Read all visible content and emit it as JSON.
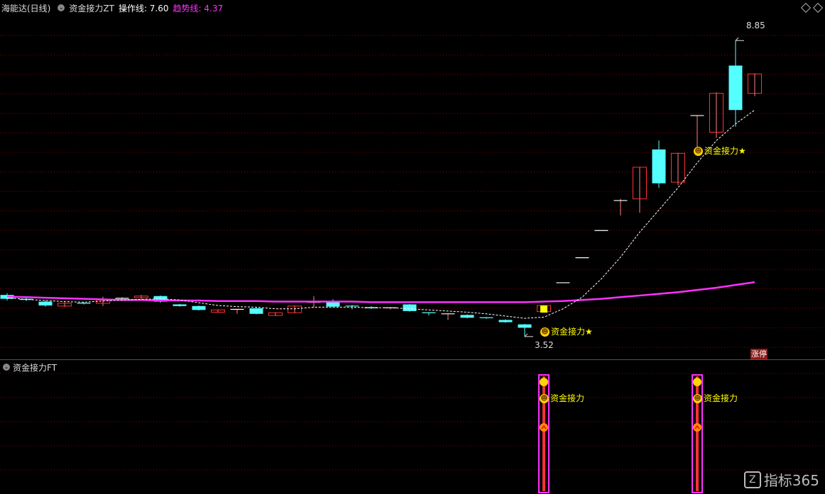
{
  "header": {
    "stock": "海能达(日线)",
    "indicator": "资金接力ZT",
    "op_label": "操作线: 7.60",
    "trend_label": "趋势线: 4.37"
  },
  "sub_header": {
    "title": "资金接力FT"
  },
  "annotations": {
    "high": "8.85",
    "low": "3.52",
    "signal_main": "资金接力★",
    "signal_sub": "资金接力",
    "badge": "涨停"
  },
  "watermark": {
    "text": "指标365"
  },
  "colors": {
    "up": "#ff3232",
    "down": "#54ffff",
    "trend": "#ff32ff",
    "signal_text": "#ffff00",
    "grid": "#8b0000"
  },
  "chart_data": {
    "type": "candlestick",
    "y_range": [
      3.2,
      9.3
    ],
    "candles": [
      {
        "o": 4.27,
        "c": 4.2,
        "h": 4.3,
        "l": 4.17
      },
      {
        "o": 4.2,
        "c": 4.18,
        "h": 4.22,
        "l": 4.16
      },
      {
        "o": 4.15,
        "c": 4.08,
        "h": 4.17,
        "l": 4.06
      },
      {
        "o": 4.07,
        "c": 4.12,
        "h": 4.14,
        "l": 4.05
      },
      {
        "o": 4.12,
        "c": 4.11,
        "h": 4.14,
        "l": 4.1
      },
      {
        "o": 4.12,
        "c": 4.18,
        "h": 4.24,
        "l": 4.07
      },
      {
        "o": 4.2,
        "c": 4.21,
        "h": 4.23,
        "l": 4.19
      },
      {
        "o": 4.22,
        "c": 4.25,
        "h": 4.27,
        "l": 4.2
      },
      {
        "o": 4.25,
        "c": 4.15,
        "h": 4.26,
        "l": 4.13
      },
      {
        "o": 4.1,
        "c": 4.07,
        "h": 4.11,
        "l": 4.06
      },
      {
        "o": 4.07,
        "c": 4.0,
        "h": 4.08,
        "l": 3.99
      },
      {
        "o": 3.96,
        "c": 4.0,
        "h": 4.01,
        "l": 3.95
      },
      {
        "o": 4.0,
        "c": 4.01,
        "h": 4.02,
        "l": 3.93
      },
      {
        "o": 4.03,
        "c": 3.93,
        "h": 4.04,
        "l": 3.92
      },
      {
        "o": 3.9,
        "c": 3.95,
        "h": 3.96,
        "l": 3.89
      },
      {
        "o": 3.95,
        "c": 4.07,
        "h": 4.08,
        "l": 3.94
      },
      {
        "o": 4.13,
        "c": 4.14,
        "h": 4.25,
        "l": 4.05
      },
      {
        "o": 4.15,
        "c": 4.06,
        "h": 4.19,
        "l": 4.05
      },
      {
        "o": 4.07,
        "c": 4.06,
        "h": 4.09,
        "l": 4.01
      },
      {
        "o": 4.05,
        "c": 4.03,
        "h": 4.07,
        "l": 4.02
      },
      {
        "o": 4.03,
        "c": 4.04,
        "h": 4.05,
        "l": 4.01
      },
      {
        "o": 4.1,
        "c": 3.98,
        "h": 4.11,
        "l": 3.97
      },
      {
        "o": 3.95,
        "c": 3.94,
        "h": 3.96,
        "l": 3.9
      },
      {
        "o": 3.92,
        "c": 3.93,
        "h": 3.94,
        "l": 3.82
      },
      {
        "o": 3.91,
        "c": 3.86,
        "h": 3.92,
        "l": 3.85
      },
      {
        "o": 3.86,
        "c": 3.85,
        "h": 3.87,
        "l": 3.84
      },
      {
        "o": 3.82,
        "c": 3.78,
        "h": 3.83,
        "l": 3.77
      },
      {
        "o": 3.74,
        "c": 3.68,
        "h": 3.75,
        "l": 3.52
      },
      {
        "o": 3.97,
        "c": 4.08,
        "h": 4.09,
        "l": 3.96
      },
      {
        "o": 4.49,
        "c": 4.49,
        "h": 4.49,
        "l": 4.49
      },
      {
        "o": 4.94,
        "c": 4.94,
        "h": 4.94,
        "l": 4.94
      },
      {
        "o": 5.43,
        "c": 5.43,
        "h": 5.43,
        "l": 5.43
      },
      {
        "o": 5.97,
        "c": 5.97,
        "h": 6.0,
        "l": 5.7
      },
      {
        "o": 6.0,
        "c": 6.57,
        "h": 6.57,
        "l": 5.75
      },
      {
        "o": 6.89,
        "c": 6.28,
        "h": 7.05,
        "l": 6.2
      },
      {
        "o": 6.3,
        "c": 6.82,
        "h": 6.83,
        "l": 6.25
      },
      {
        "o": 7.5,
        "c": 7.5,
        "h": 7.5,
        "l": 6.83
      },
      {
        "o": 7.2,
        "c": 7.9,
        "h": 7.92,
        "l": 7.1
      },
      {
        "o": 8.4,
        "c": 7.6,
        "h": 8.85,
        "l": 7.3
      },
      {
        "o": 7.9,
        "c": 8.25,
        "h": 8.26,
        "l": 7.85
      }
    ],
    "trend_line": [
      4.24,
      4.23,
      4.22,
      4.21,
      4.2,
      4.19,
      4.18,
      4.18,
      4.17,
      4.17,
      4.17,
      4.16,
      4.16,
      4.16,
      4.15,
      4.15,
      4.15,
      4.15,
      4.15,
      4.14,
      4.14,
      4.14,
      4.14,
      4.14,
      4.14,
      4.14,
      4.14,
      4.14,
      4.15,
      4.16,
      4.18,
      4.2,
      4.23,
      4.26,
      4.29,
      4.32,
      4.36,
      4.4,
      4.45,
      4.5
    ],
    "op_line": [
      4.22,
      4.19,
      4.17,
      4.15,
      4.14,
      4.16,
      4.18,
      4.19,
      4.2,
      4.18,
      4.13,
      4.08,
      4.06,
      4.05,
      4.02,
      4.02,
      4.05,
      4.05,
      4.05,
      4.04,
      4.04,
      4.02,
      4.0,
      3.98,
      3.96,
      3.93,
      3.89,
      3.85,
      3.87,
      4.02,
      4.23,
      4.56,
      4.95,
      5.4,
      5.8,
      6.2,
      6.65,
      7.05,
      7.35,
      7.6
    ],
    "signals": [
      28,
      36
    ]
  }
}
